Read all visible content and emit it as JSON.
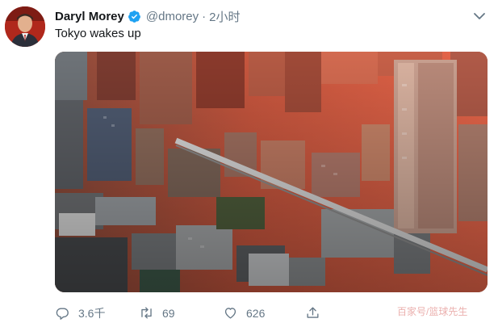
{
  "tweet": {
    "author_name": "Daryl Morey",
    "handle": "@dmorey",
    "separator": "·",
    "time": "2小时",
    "text": "Tokyo wakes up"
  },
  "actions": {
    "reply_count": "3.6千",
    "retweet_count": "69",
    "like_count": "626"
  },
  "watermark": "百家号/篮球先生",
  "colors": {
    "accent_blue": "#1da1f2",
    "secondary_text": "#657786",
    "primary_text": "#14171a"
  },
  "icons": [
    "verified-badge-icon",
    "chevron-down-icon",
    "reply-icon",
    "retweet-icon",
    "like-icon",
    "share-icon"
  ]
}
